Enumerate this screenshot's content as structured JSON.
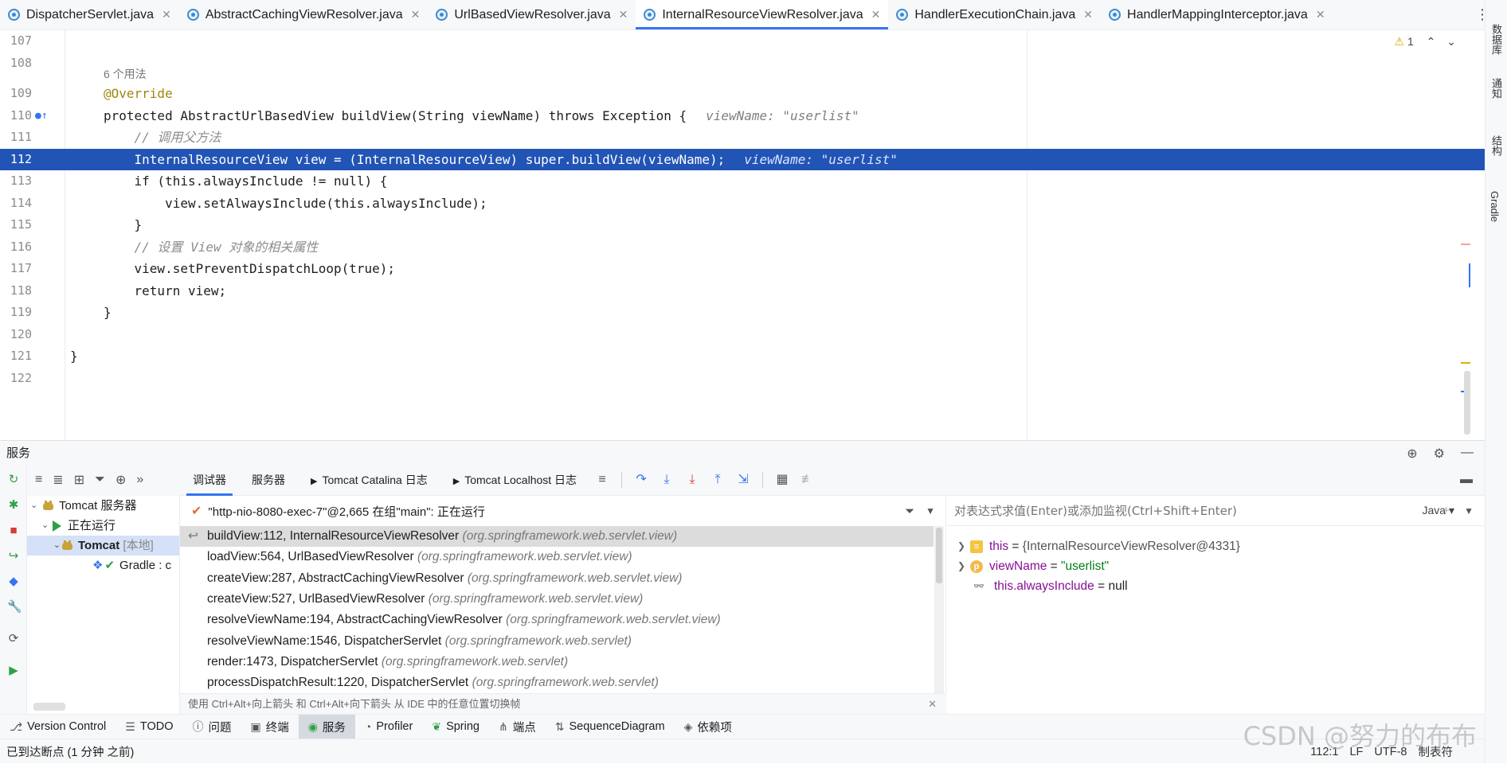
{
  "tabs": [
    {
      "label": "DispatcherServlet.java",
      "active": false
    },
    {
      "label": "AbstractCachingViewResolver.java",
      "active": false
    },
    {
      "label": "UrlBasedViewResolver.java",
      "active": false
    },
    {
      "label": "InternalResourceViewResolver.java",
      "active": true
    },
    {
      "label": "HandlerExecutionChain.java",
      "active": false
    },
    {
      "label": "HandlerMappingInterceptor.java",
      "active": false
    }
  ],
  "editor": {
    "warning_count": "1",
    "usage_hint": "6 个用法",
    "lines": [
      {
        "num": "107",
        "code": ""
      },
      {
        "num": "108",
        "code": ""
      },
      {
        "num": "109",
        "code": "@Override"
      },
      {
        "num": "110",
        "code": "protected AbstractUrlBasedView buildView(String viewName) throws Exception {",
        "hint": "viewName: \"userlist\""
      },
      {
        "num": "111",
        "code": "    // 调用父方法"
      },
      {
        "num": "112",
        "code": "    InternalResourceView view = (InternalResourceView) super.buildView(viewName);",
        "hint": "viewName: \"userlist\""
      },
      {
        "num": "113",
        "code": "    if (this.alwaysInclude != null) {"
      },
      {
        "num": "114",
        "code": "        view.setAlwaysInclude(this.alwaysInclude);"
      },
      {
        "num": "115",
        "code": "    }"
      },
      {
        "num": "116",
        "code": "    // 设置 View 对象的相关属性"
      },
      {
        "num": "117",
        "code": "    view.setPreventDispatchLoop(true);"
      },
      {
        "num": "118",
        "code": "    return view;"
      },
      {
        "num": "119",
        "code": "}"
      },
      {
        "num": "120",
        "code": ""
      },
      {
        "num": "121",
        "code": "}"
      },
      {
        "num": "122",
        "code": ""
      }
    ]
  },
  "right_tools": [
    "数据库",
    "通知",
    "结构",
    "Gradle"
  ],
  "services": {
    "title": "服务",
    "tree": {
      "root": "Tomcat 服务器",
      "running": "正在运行",
      "tomcat": "Tomcat",
      "tomcat_tag": "[本地]",
      "gradle": "Gradle : c"
    }
  },
  "debugger_tabs": [
    "调试器",
    "服务器",
    "Tomcat Catalina 日志",
    "Tomcat Localhost 日志"
  ],
  "thread": "\"http-nio-8080-exec-7\"@2,665 在组\"main\": 正在运行",
  "frames": [
    {
      "method": "buildView:112, InternalResourceViewResolver",
      "pkg": "(org.springframework.web.servlet.view)"
    },
    {
      "method": "loadView:564, UrlBasedViewResolver",
      "pkg": "(org.springframework.web.servlet.view)"
    },
    {
      "method": "createView:287, AbstractCachingViewResolver",
      "pkg": "(org.springframework.web.servlet.view)"
    },
    {
      "method": "createView:527, UrlBasedViewResolver",
      "pkg": "(org.springframework.web.servlet.view)"
    },
    {
      "method": "resolveViewName:194, AbstractCachingViewResolver",
      "pkg": "(org.springframework.web.servlet.view)"
    },
    {
      "method": "resolveViewName:1546, DispatcherServlet",
      "pkg": "(org.springframework.web.servlet)"
    },
    {
      "method": "render:1473, DispatcherServlet",
      "pkg": "(org.springframework.web.servlet)"
    },
    {
      "method": "processDispatchResult:1220, DispatcherServlet",
      "pkg": "(org.springframework.web.servlet)"
    }
  ],
  "frames_hint": "使用 Ctrl+Alt+向上箭头 和 Ctrl+Alt+向下箭头 从 IDE 中的任意位置切换帧",
  "variables": {
    "eval_placeholder": "对表达式求值(Enter)或添加监视(Ctrl+Shift+Enter)",
    "language": "Java",
    "items": [
      {
        "name": "this",
        "value": "{InternalResourceViewResolver@4331}",
        "kind": "object"
      },
      {
        "name": "viewName",
        "value": "\"userlist\"",
        "kind": "param"
      },
      {
        "name": "this.alwaysInclude",
        "value": "null",
        "kind": "watch"
      }
    ]
  },
  "tool_windows": [
    "Version Control",
    "TODO",
    "问题",
    "终端",
    "服务",
    "Profiler",
    "Spring",
    "端点",
    "SequenceDiagram",
    "依赖项"
  ],
  "status": {
    "message": "已到达断点 (1 分钟 之前)",
    "position": "112:1",
    "line_sep": "LF",
    "encoding": "UTF-8",
    "indent": "制表符"
  },
  "watermark": "CSDN @努力的布布",
  "colors": {
    "selection": "#2154b5",
    "accent": "#3574f0",
    "keyword": "#0033b3",
    "field": "#871094"
  }
}
